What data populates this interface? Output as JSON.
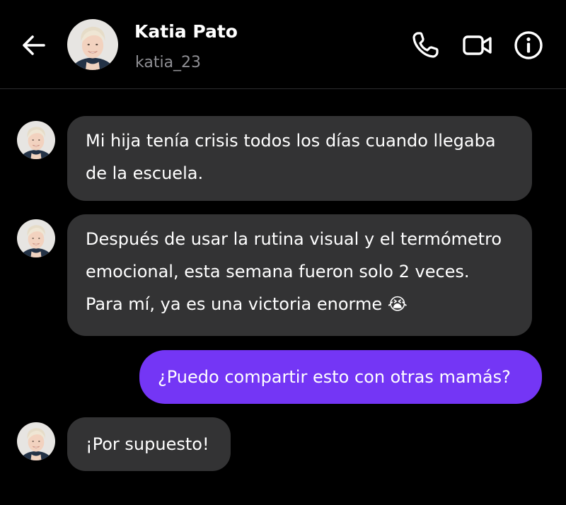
{
  "header": {
    "name": "Katia Pato",
    "username": "katia_23",
    "icons": [
      "back-arrow-icon",
      "phone-icon",
      "video-camera-icon",
      "info-icon"
    ]
  },
  "messages": [
    {
      "direction": "incoming",
      "lines": [
        "Mi hija tenía crisis todos los días cuando llegaba",
        "de la escuela."
      ]
    },
    {
      "direction": "incoming",
      "lines": [
        "Después de usar la rutina visual y el termómetro",
        "emocional, esta semana fueron solo 2 veces.",
        "Para mí, ya es una victoria enorme 😭"
      ]
    },
    {
      "direction": "outgoing",
      "lines": [
        "¿Puedo compartir esto con otras mamás?"
      ]
    },
    {
      "direction": "incoming",
      "lines": [
        "¡Por supuesto!"
      ]
    }
  ],
  "colors": {
    "background": "#000000",
    "incoming_bubble": "#333334",
    "outgoing_bubble": "#7436f5",
    "secondary_text": "#8e8e93"
  }
}
